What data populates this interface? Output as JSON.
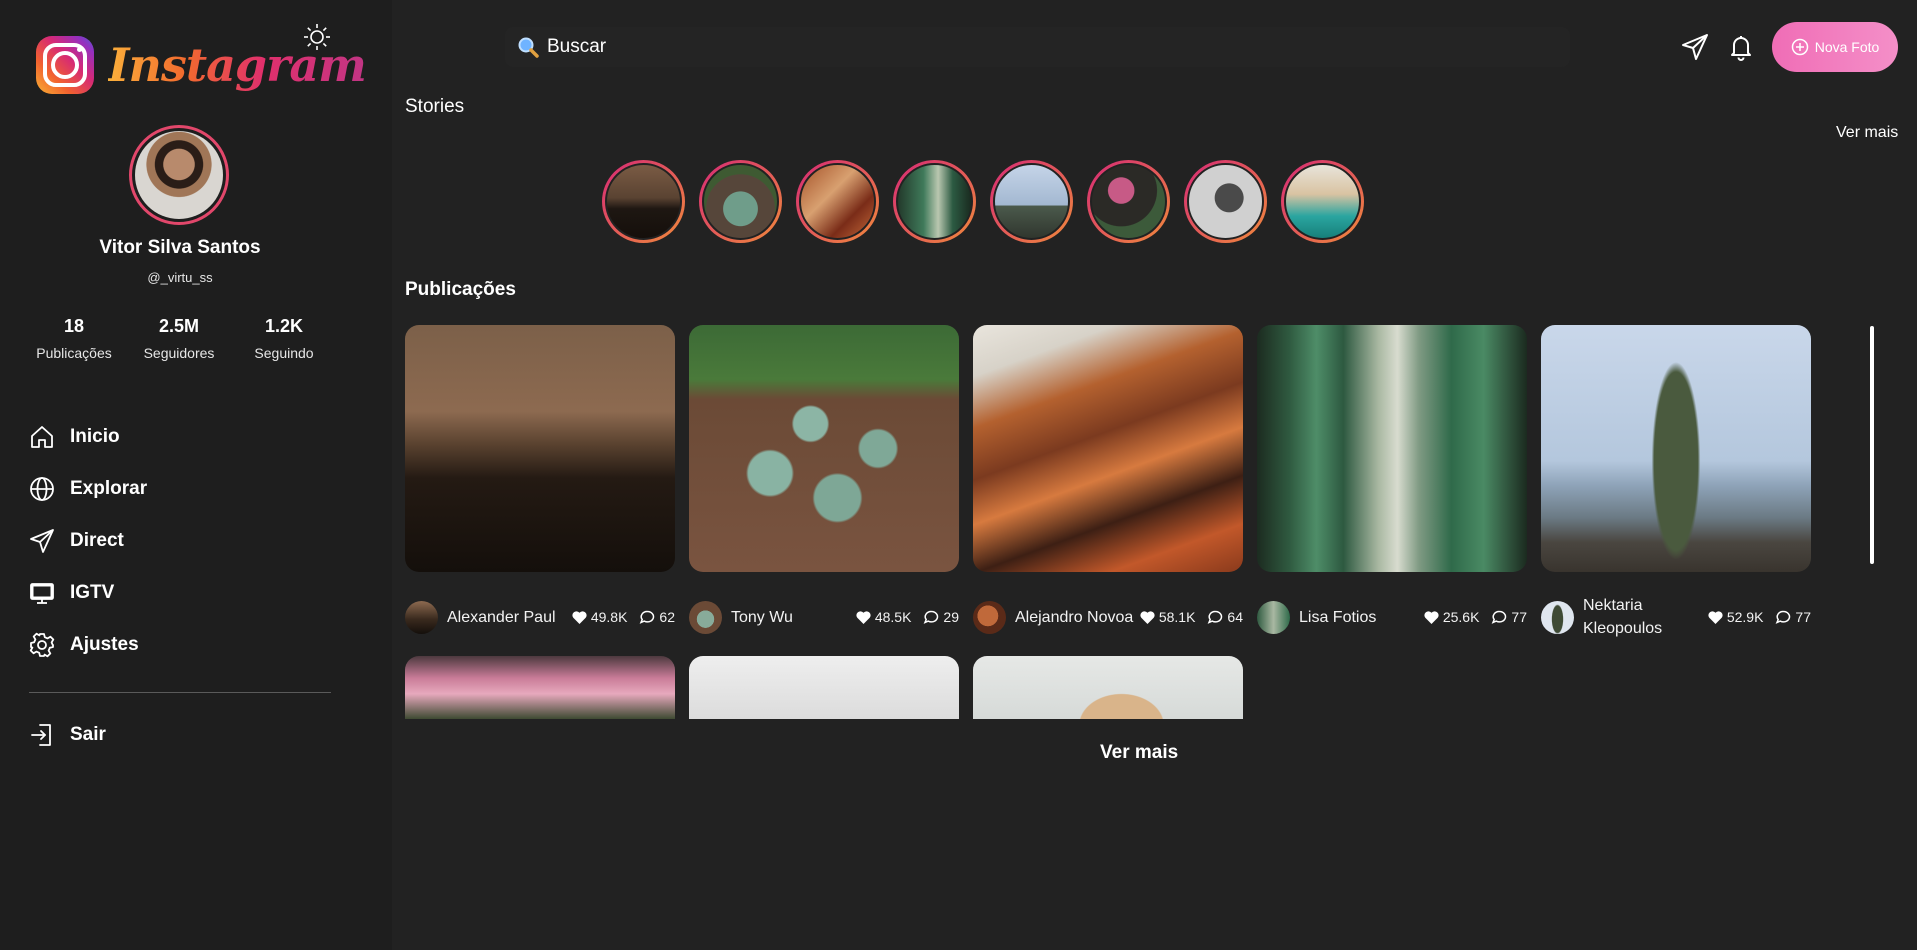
{
  "app": {
    "name": "Instagram"
  },
  "profile": {
    "name": "Vitor Silva Santos",
    "handle": "@_virtu_ss",
    "stats": [
      {
        "value": "18",
        "label": "Publicações"
      },
      {
        "value": "2.5M",
        "label": "Seguidores"
      },
      {
        "value": "1.2K",
        "label": "Seguindo"
      }
    ]
  },
  "nav": [
    {
      "label": "Inicio",
      "icon": "home-icon"
    },
    {
      "label": "Explorar",
      "icon": "globe-icon"
    },
    {
      "label": "Direct",
      "icon": "send-icon"
    },
    {
      "label": "IGTV",
      "icon": "tv-icon"
    },
    {
      "label": "Ajustes",
      "icon": "gear-icon"
    }
  ],
  "logout": {
    "label": "Sair",
    "icon": "logout-icon"
  },
  "search": {
    "label": "Buscar",
    "icon": "search-icon"
  },
  "header": {
    "new_photo": "Nova Foto"
  },
  "stories": {
    "title": "Stories",
    "see_more": "Ver mais",
    "count": 8
  },
  "posts": {
    "title": "Publicações",
    "items": [
      {
        "author": "Alexander Paul",
        "likes": "49.8K",
        "comments": "62"
      },
      {
        "author": "Tony Wu",
        "likes": "48.5K",
        "comments": "29"
      },
      {
        "author": "Alejandro Novoa",
        "likes": "58.1K",
        "comments": "64"
      },
      {
        "author": "Lisa Fotios",
        "likes": "25.6K",
        "comments": "77"
      },
      {
        "author": "Nektaria Kleopoulos",
        "likes": "52.9K",
        "comments": "77"
      }
    ],
    "see_more": "Ver mais"
  },
  "colors": {
    "background": "#222222",
    "sidebar": "#1e1e1e",
    "accent": "#f06db6"
  }
}
